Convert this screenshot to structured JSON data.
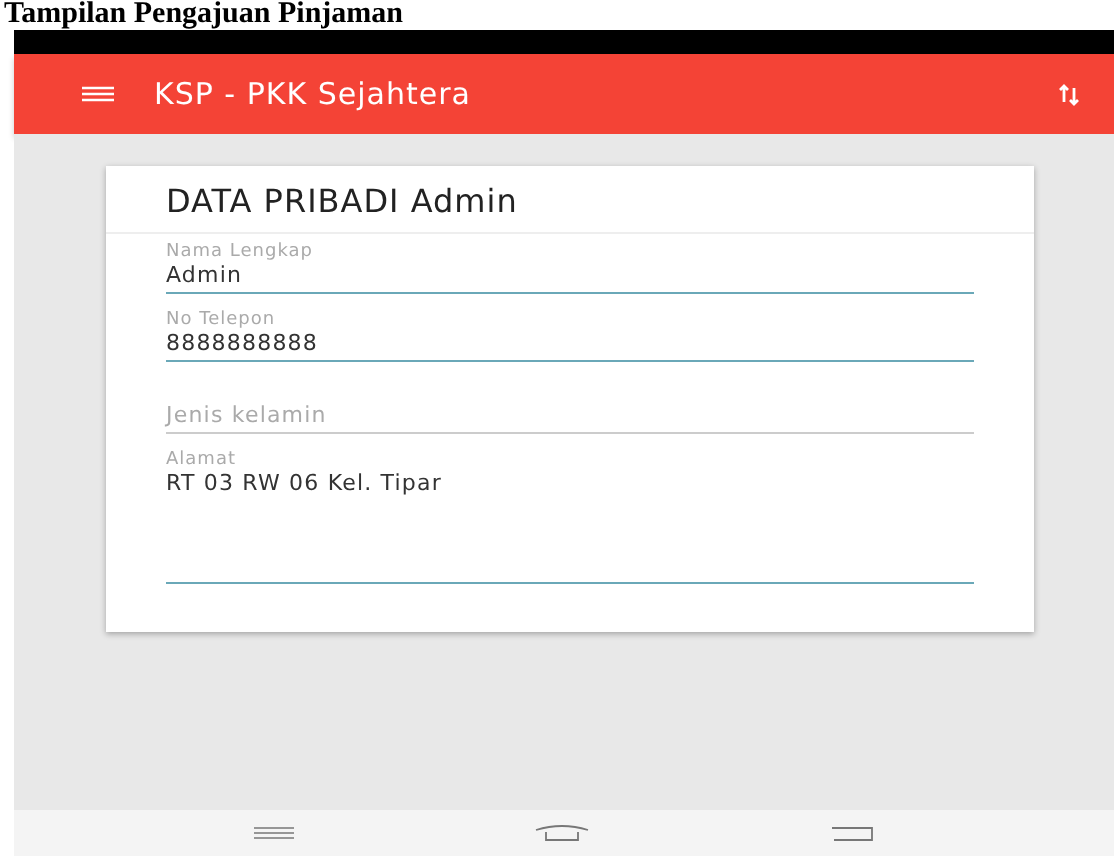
{
  "caption": "Tampilan Pengajuan Pinjaman",
  "app_bar": {
    "title": "KSP - PKK Sejahtera"
  },
  "card": {
    "title": "DATA PRIBADI Admin",
    "fields": [
      {
        "kind": "text",
        "label": "Nama Lengkap",
        "value": "Admin"
      },
      {
        "kind": "text",
        "label": "No Telepon",
        "value": "8888888888"
      },
      {
        "kind": "select",
        "placeholder": "Jenis kelamin"
      },
      {
        "kind": "textarea",
        "label": "Alamat",
        "value": "RT 03 RW 06 Kel. Tipar"
      }
    ]
  }
}
